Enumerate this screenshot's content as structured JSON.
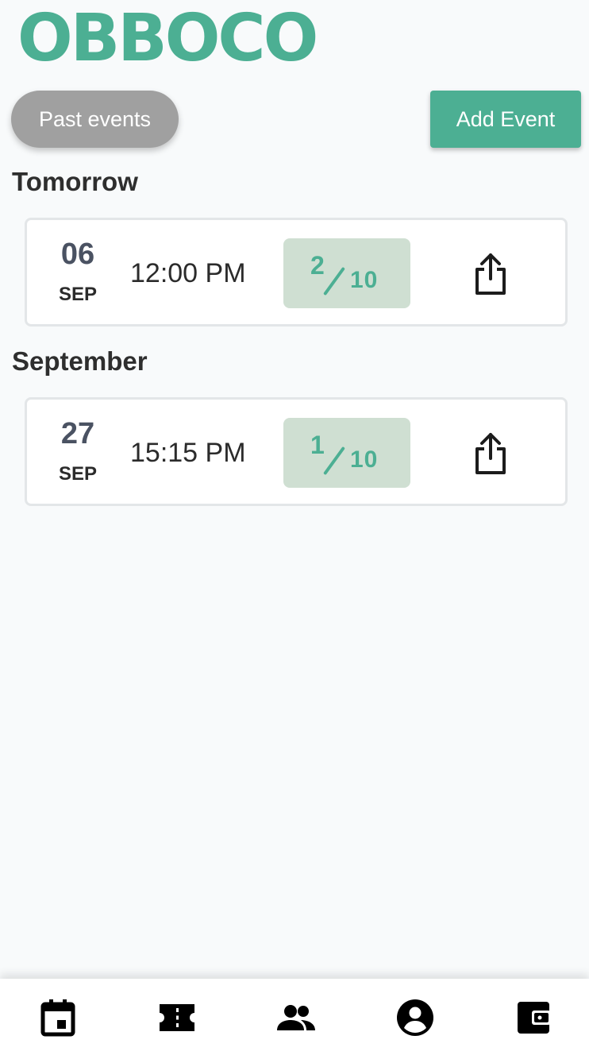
{
  "app": {
    "logo_text": "OBBOCO"
  },
  "header": {
    "past_events_label": "Past events",
    "add_event_label": "Add Event"
  },
  "sections": [
    {
      "title": "Tomorrow",
      "events": [
        {
          "day": "06",
          "month": "SEP",
          "time": "12:00 PM",
          "count": "2",
          "capacity": "10"
        }
      ]
    },
    {
      "title": "September",
      "events": [
        {
          "day": "27",
          "month": "SEP",
          "time": "15:15 PM",
          "count": "1",
          "capacity": "10"
        }
      ]
    }
  ],
  "bottom_nav": {
    "items": [
      {
        "icon": "calendar-icon"
      },
      {
        "icon": "ticket-icon"
      },
      {
        "icon": "people-icon"
      },
      {
        "icon": "account-circle-icon"
      },
      {
        "icon": "wallet-icon"
      }
    ]
  },
  "colors": {
    "accent": "#4caf93",
    "count_badge_bg": "#cfdfd2",
    "past_button_bg": "#a0a0a0",
    "background": "#f8fafb"
  }
}
